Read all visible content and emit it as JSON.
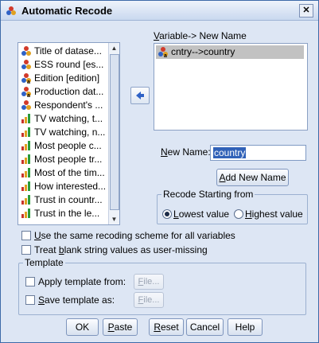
{
  "window": {
    "title": "Automatic Recode",
    "close_label": "✕"
  },
  "variables": {
    "items": [
      {
        "label": "Title of datase...",
        "type": "nominal"
      },
      {
        "label": "ESS round [es...",
        "type": "nominal"
      },
      {
        "label": "Edition [edition]",
        "type": "nominal-string"
      },
      {
        "label": "Production dat...",
        "type": "nominal-string"
      },
      {
        "label": "Respondent's ...",
        "type": "nominal"
      },
      {
        "label": "TV watching, t...",
        "type": "scale"
      },
      {
        "label": "TV watching, n...",
        "type": "scale"
      },
      {
        "label": "Most people c...",
        "type": "scale"
      },
      {
        "label": "Most people tr...",
        "type": "scale"
      },
      {
        "label": "Most of the tim...",
        "type": "scale"
      },
      {
        "label": "How interested...",
        "type": "scale"
      },
      {
        "label": "Trust in countr...",
        "type": "scale"
      },
      {
        "label": "Trust in the le...",
        "type": "scale"
      }
    ]
  },
  "mapping": {
    "header": "Variable-> New Name",
    "header_hotkey": "V",
    "header_rest": "ariable-> New Name",
    "selected_item": "cntry-->country"
  },
  "new_name": {
    "label_hotkey": "N",
    "label_rest": "ew Name:",
    "value": "country",
    "add_button_hotkey": "A",
    "add_button_rest": "dd New Name"
  },
  "recode_start": {
    "legend": "Recode Starting from",
    "lowest_hotkey": "L",
    "lowest_rest": "owest value",
    "highest_hotkey": "H",
    "highest_rest": "ighest value",
    "selected": "lowest"
  },
  "options": {
    "same_scheme_hotkey": "U",
    "same_scheme_rest": "se the same recoding scheme for all variables",
    "blank_pre": "Treat ",
    "blank_hotkey": "b",
    "blank_rest": "lank string values as user-missing"
  },
  "template": {
    "legend": "Template",
    "apply_label": "Apply template from:",
    "save_hotkey": "S",
    "save_rest": "ave template as:",
    "file_hotkey": "F",
    "file_rest": "ile..."
  },
  "buttons": {
    "ok": "OK",
    "paste_hotkey": "P",
    "paste_rest": "aste",
    "reset_hotkey": "R",
    "reset_rest": "eset",
    "cancel": "Cancel",
    "help": "Help"
  },
  "colors": {
    "accent": "#3162b8",
    "background": "#dde6f4",
    "selected_row": "#c2c2c2"
  }
}
